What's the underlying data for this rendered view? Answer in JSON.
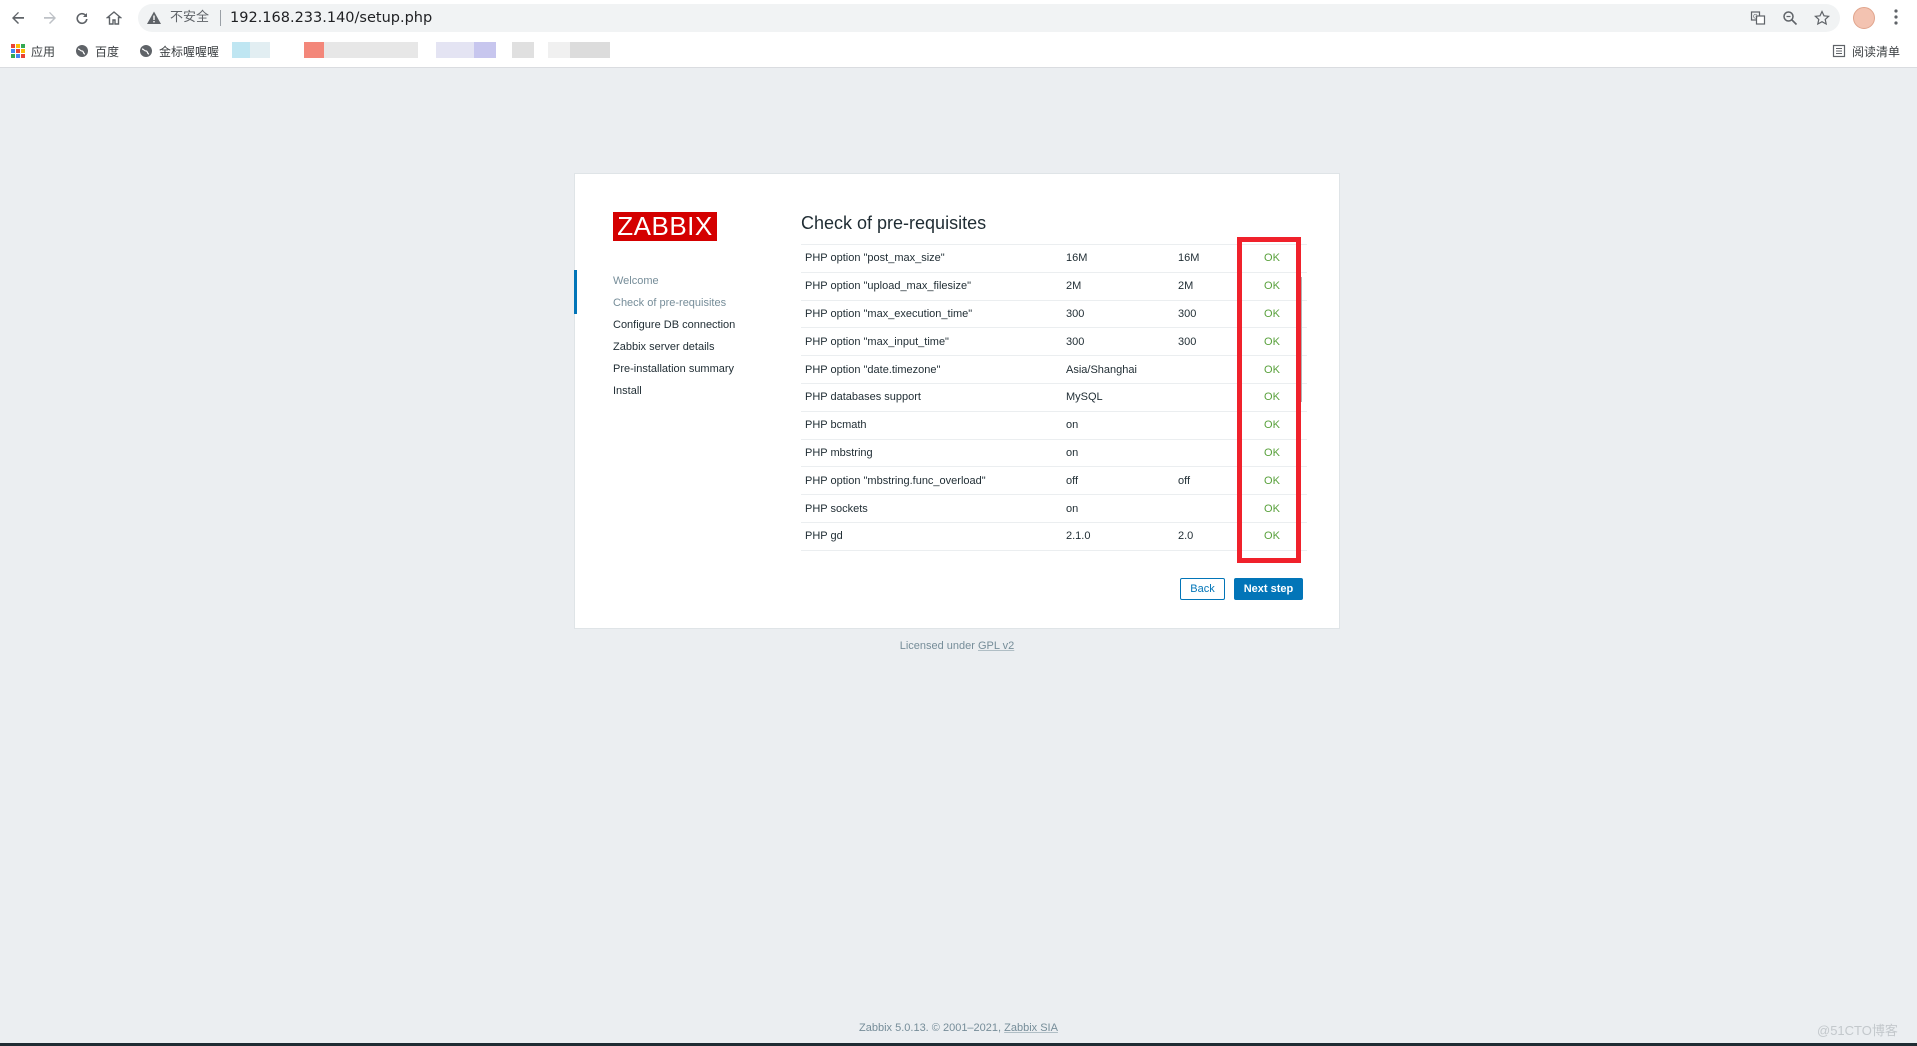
{
  "browser": {
    "insecure_label": "不安全",
    "url": "192.168.233.140/setup.php",
    "bookmarks": {
      "apps_label": "应用",
      "baidu_label": "百度",
      "jinbiao_label": "金标喔喔喔",
      "reading_list_label": "阅读清单"
    }
  },
  "logo_text": "ZABBIX",
  "steps": [
    {
      "label": "Welcome",
      "state": "done"
    },
    {
      "label": "Check of pre-requisites",
      "state": "current"
    },
    {
      "label": "Configure DB connection",
      "state": "pending"
    },
    {
      "label": "Zabbix server details",
      "state": "pending"
    },
    {
      "label": "Pre-installation summary",
      "state": "pending"
    },
    {
      "label": "Install",
      "state": "pending"
    }
  ],
  "title": "Check of pre-requisites",
  "requirements": [
    {
      "name": "PHP option \"post_max_size\"",
      "current": "16M",
      "required": "16M",
      "result": "OK"
    },
    {
      "name": "PHP option \"upload_max_filesize\"",
      "current": "2M",
      "required": "2M",
      "result": "OK"
    },
    {
      "name": "PHP option \"max_execution_time\"",
      "current": "300",
      "required": "300",
      "result": "OK"
    },
    {
      "name": "PHP option \"max_input_time\"",
      "current": "300",
      "required": "300",
      "result": "OK"
    },
    {
      "name": "PHP option \"date.timezone\"",
      "current": "Asia/Shanghai",
      "required": "",
      "result": "OK"
    },
    {
      "name": "PHP databases support",
      "current": "MySQL",
      "required": "",
      "result": "OK"
    },
    {
      "name": "PHP bcmath",
      "current": "on",
      "required": "",
      "result": "OK"
    },
    {
      "name": "PHP mbstring",
      "current": "on",
      "required": "",
      "result": "OK"
    },
    {
      "name": "PHP option \"mbstring.func_overload\"",
      "current": "off",
      "required": "off",
      "result": "OK"
    },
    {
      "name": "PHP sockets",
      "current": "on",
      "required": "",
      "result": "OK"
    },
    {
      "name": "PHP gd",
      "current": "2.1.0",
      "required": "2.0",
      "result": "OK"
    }
  ],
  "buttons": {
    "back": "Back",
    "next": "Next step"
  },
  "license": {
    "prefix": "Licensed under",
    "link": "GPL v2"
  },
  "footer": {
    "prefix": "Zabbix 5.0.13. © 2001–2021,",
    "link": "Zabbix SIA"
  },
  "watermark": "@51CTO博客",
  "colors": {
    "brand_red": "#d40000",
    "ok_green": "#59a13c",
    "primary_blue": "#0275b8",
    "highlight_red": "#f0212b"
  }
}
